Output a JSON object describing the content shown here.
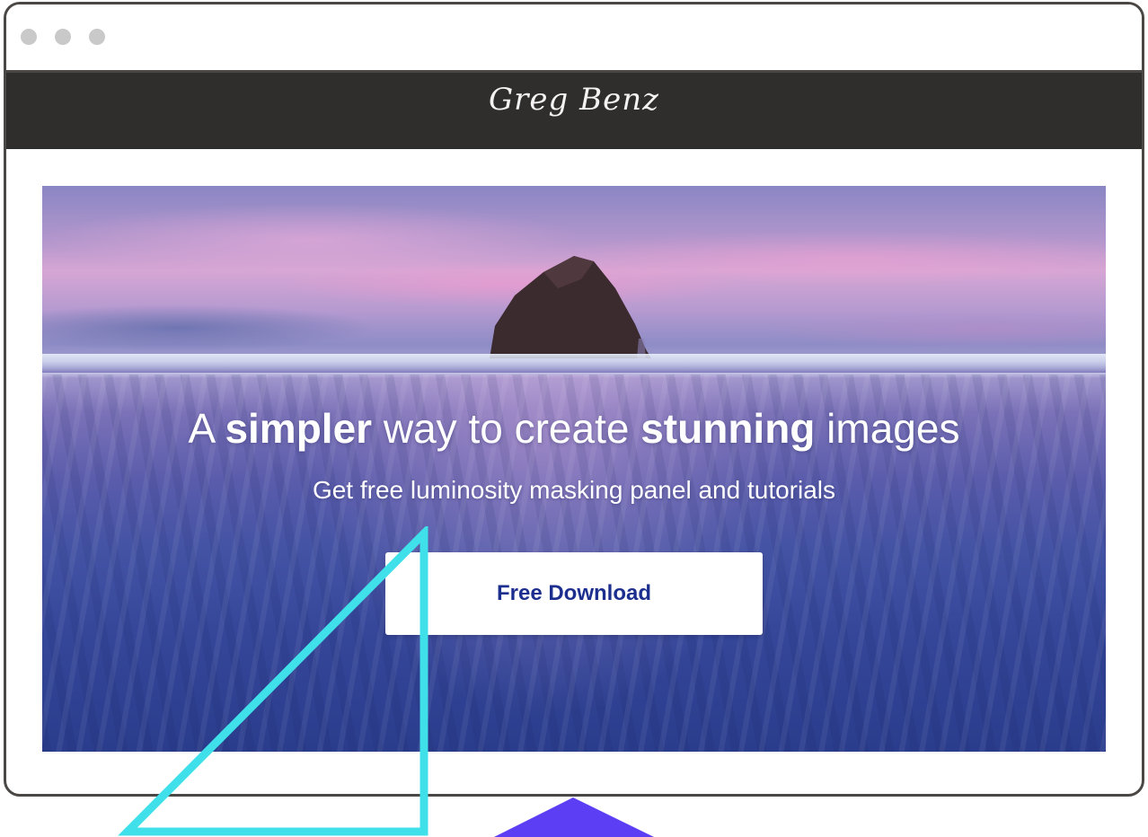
{
  "site": {
    "logo_text": "Greg Benz"
  },
  "hero": {
    "headline": {
      "part1": "A ",
      "bold1": "simpler",
      "part2": " way to create ",
      "bold2": "stunning",
      "part3": " images"
    },
    "subheadline": "Get free luminosity masking panel and tutorials",
    "cta_label": "Free Download"
  },
  "colors": {
    "header_bg": "#302e2c",
    "frame_border": "#4a4745",
    "cta_text": "#1c2f8f",
    "accent_cyan": "#3fe0ea",
    "accent_purple": "#5c3ff4"
  },
  "icons": [
    "window-dot-icon",
    "sea-stack-rock"
  ]
}
